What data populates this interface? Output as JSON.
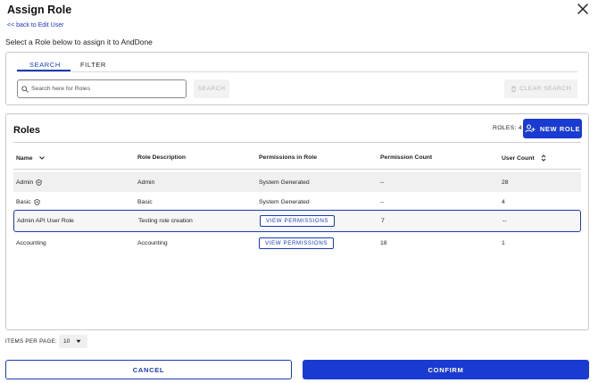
{
  "dialog": {
    "title": "Assign Role",
    "back_link": "<< back to Edit User",
    "subtitle": "Select a Role below to assign it to AndDone"
  },
  "search_panel": {
    "tabs": [
      {
        "label": "SEARCH",
        "active": true
      },
      {
        "label": "FILTER",
        "active": false
      }
    ],
    "search_placeholder": "Search here for Roles",
    "search_button": "SEARCH",
    "clear_button": "CLEAR SEARCH"
  },
  "roles": {
    "title": "Roles",
    "count_label": "ROLES: 4",
    "new_role_button": "NEW ROLE",
    "columns": [
      "Name",
      "Role Description",
      "Permissions in Role",
      "Permission Count",
      "User Count"
    ],
    "rows": [
      {
        "name": "Admin",
        "shield": true,
        "description": "Admin",
        "permissions": "System Generated",
        "permissions_is_button": false,
        "permission_count": "--",
        "user_count": "28"
      },
      {
        "name": "Basic",
        "shield": true,
        "description": "Basic",
        "permissions": "System Generated",
        "permissions_is_button": false,
        "permission_count": "--",
        "user_count": "4"
      },
      {
        "name": "Admin API User Role",
        "shield": false,
        "description": "Testing role creation",
        "permissions": "VIEW PERMISSIONS",
        "permissions_is_button": true,
        "permission_count": "7",
        "user_count": "--",
        "selected": true
      },
      {
        "name": "Accounting",
        "shield": false,
        "description": "Accounting",
        "permissions": "VIEW PERMISSIONS",
        "permissions_is_button": true,
        "permission_count": "18",
        "user_count": "1"
      }
    ]
  },
  "pagination": {
    "items_per_page_label": "ITEMS PER PAGE:",
    "items_per_page_value": "10"
  },
  "footer": {
    "cancel_button": "CANCEL",
    "confirm_button": "CONFIRM"
  },
  "colors": {
    "accent": "#1a3bd1",
    "link": "#1a3bb5"
  }
}
